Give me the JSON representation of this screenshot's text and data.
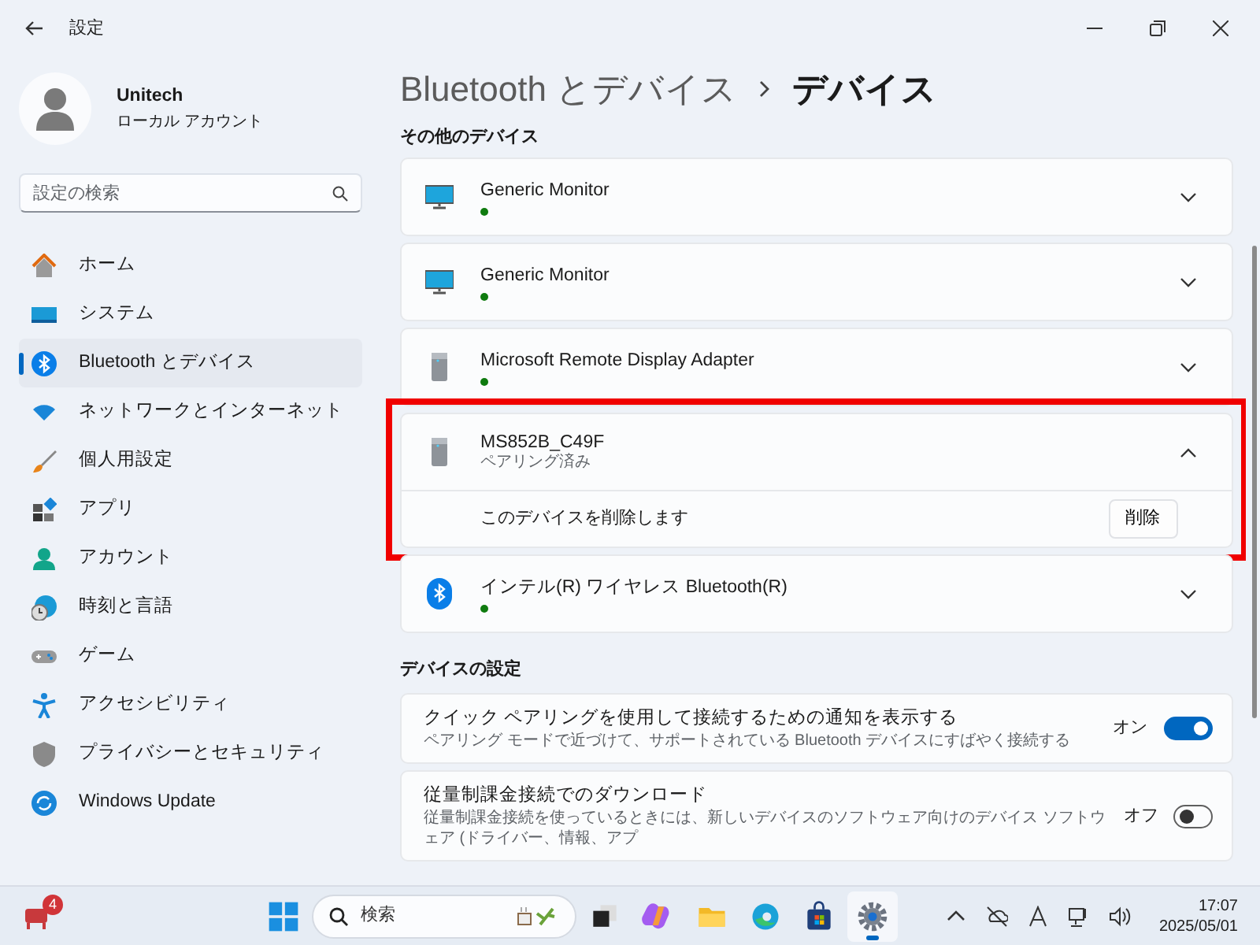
{
  "window": {
    "title": "設定"
  },
  "account": {
    "name": "Unitech",
    "type": "ローカル アカウント"
  },
  "search": {
    "placeholder": "設定の検索"
  },
  "sidebar": {
    "items": [
      {
        "label": "ホーム",
        "kind": "home",
        "selected": false
      },
      {
        "label": "システム",
        "kind": "system",
        "selected": false
      },
      {
        "label": "Bluetooth とデバイス",
        "kind": "bluetooth",
        "selected": true
      },
      {
        "label": "ネットワークとインターネット",
        "kind": "network",
        "selected": false
      },
      {
        "label": "個人用設定",
        "kind": "brush",
        "selected": false
      },
      {
        "label": "アプリ",
        "kind": "apps",
        "selected": false
      },
      {
        "label": "アカウント",
        "kind": "account",
        "selected": false
      },
      {
        "label": "時刻と言語",
        "kind": "time",
        "selected": false
      },
      {
        "label": "ゲーム",
        "kind": "gaming",
        "selected": false
      },
      {
        "label": "アクセシビリティ",
        "kind": "accessibility",
        "selected": false
      },
      {
        "label": "プライバシーとセキュリティ",
        "kind": "privacy",
        "selected": false
      },
      {
        "label": "Windows Update",
        "kind": "update",
        "selected": false
      }
    ]
  },
  "breadcrumb": {
    "parent": "Bluetooth とデバイス",
    "current": "デバイス"
  },
  "device_sections": [
    {
      "title": "その他のデバイス",
      "devices": [
        {
          "name": "Generic Monitor",
          "kind": "monitor",
          "connected": true,
          "expanded": false
        },
        {
          "name": "Generic Monitor",
          "kind": "monitor",
          "connected": true,
          "expanded": false
        },
        {
          "name": "Microsoft Remote Display Adapter",
          "kind": "tower",
          "connected": true,
          "expanded": false
        },
        {
          "name": "MS852B_C49F",
          "kind": "tower",
          "status": "ペアリング済み",
          "connected": false,
          "expanded": true,
          "highlighted": true,
          "action": {
            "label": "このデバイスを削除します",
            "button": "削除"
          }
        },
        {
          "name": "インテル(R) ワイヤレス Bluetooth(R)",
          "kind": "bluetooth",
          "connected": true,
          "expanded": false
        }
      ]
    }
  ],
  "device_settings": {
    "title": "デバイスの設定",
    "items": [
      {
        "title": "クイック ペアリングを使用して接続するための通知を表示する",
        "description": "ペアリング モードで近づけて、サポートされている Bluetooth デバイスにすばやく接続する",
        "state_label": "オン",
        "on": true
      },
      {
        "title": "従量制課金接続でのダウンロード",
        "description": "従量制課金接続を使っているときには、新しいデバイスのソフトウェア向けのデバイス ソフトウェア (ドライバー、情報、アプ",
        "state_label": "オフ",
        "on": false
      }
    ]
  },
  "taskbar": {
    "notification_count": "4",
    "search_placeholder": "検索",
    "apps": [
      {
        "kind": "start",
        "selected": false
      },
      {
        "kind": "search"
      },
      {
        "kind": "taskview",
        "selected": false
      },
      {
        "kind": "copilot",
        "selected": false
      },
      {
        "kind": "files",
        "selected": false
      },
      {
        "kind": "edge",
        "selected": false
      },
      {
        "kind": "store",
        "selected": false
      },
      {
        "kind": "settings",
        "selected": true
      }
    ],
    "clock": {
      "time": "17:07",
      "date": "2025/05/01"
    }
  }
}
